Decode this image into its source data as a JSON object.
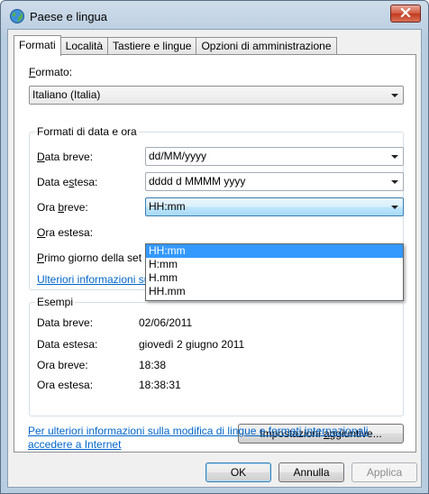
{
  "window": {
    "title": "Paese e lingua"
  },
  "tabs": [
    {
      "label": "Formati",
      "active": true
    },
    {
      "label": "Località",
      "active": false
    },
    {
      "label": "Tastiere e lingue",
      "active": false
    },
    {
      "label": "Opzioni di amministrazione",
      "active": false
    }
  ],
  "format": {
    "label_accel": "F",
    "label_rest": "ormato:",
    "value": "Italiano (Italia)"
  },
  "date_time_group": {
    "title": "Formati di data e ora",
    "short_date": {
      "label_pre": "",
      "label_accel": "D",
      "label_rest": "ata breve:",
      "value": "dd/MM/yyyy"
    },
    "long_date": {
      "label_pre": "Data e",
      "label_accel": "s",
      "label_rest": "tesa:",
      "value": "dddd d MMMM yyyy"
    },
    "short_time": {
      "label_pre": "Ora ",
      "label_accel": "b",
      "label_rest": "reve:",
      "value": "HH:mm"
    },
    "long_time": {
      "label_pre": "",
      "label_accel": "O",
      "label_rest": "ra estesa:"
    },
    "first_day": {
      "label_pre": "",
      "label_accel": "P",
      "label_rest": "rimo giorno della set"
    },
    "dropdown_options": [
      "HH:mm",
      "H:mm",
      "H.mm",
      "HH.mm"
    ],
    "selected_option": "HH:mm",
    "more_info_link": "Ulteriori informazioni sul formati di data e ora"
  },
  "examples": {
    "title": "Esempi",
    "rows": [
      {
        "label": "Data breve:",
        "value": "02/06/2011"
      },
      {
        "label": "Data estesa:",
        "value": "giovedì 2 giugno 2011"
      },
      {
        "label": "Ora breve:",
        "value": "18:38"
      },
      {
        "label": "Ora estesa:",
        "value": "18:38:31"
      }
    ]
  },
  "additional_settings": {
    "label_pre": "Impostazioni ",
    "label_accel": "a",
    "label_rest": "ggiuntive..."
  },
  "footer_link": {
    "line1": "Per ulteriori informazioni sulla modifica di lingue e formati internazionali,",
    "line2": "accedere a Internet"
  },
  "buttons": {
    "ok": "OK",
    "cancel": "Annulla",
    "apply": "Applica"
  },
  "colors": {
    "link": "#0066cc",
    "selection": "#3399ff",
    "focus_border": "#3c7fb1"
  },
  "icons": {
    "title": "globe-icon",
    "close": "close-icon",
    "dropdown": "chevron-down-icon"
  }
}
